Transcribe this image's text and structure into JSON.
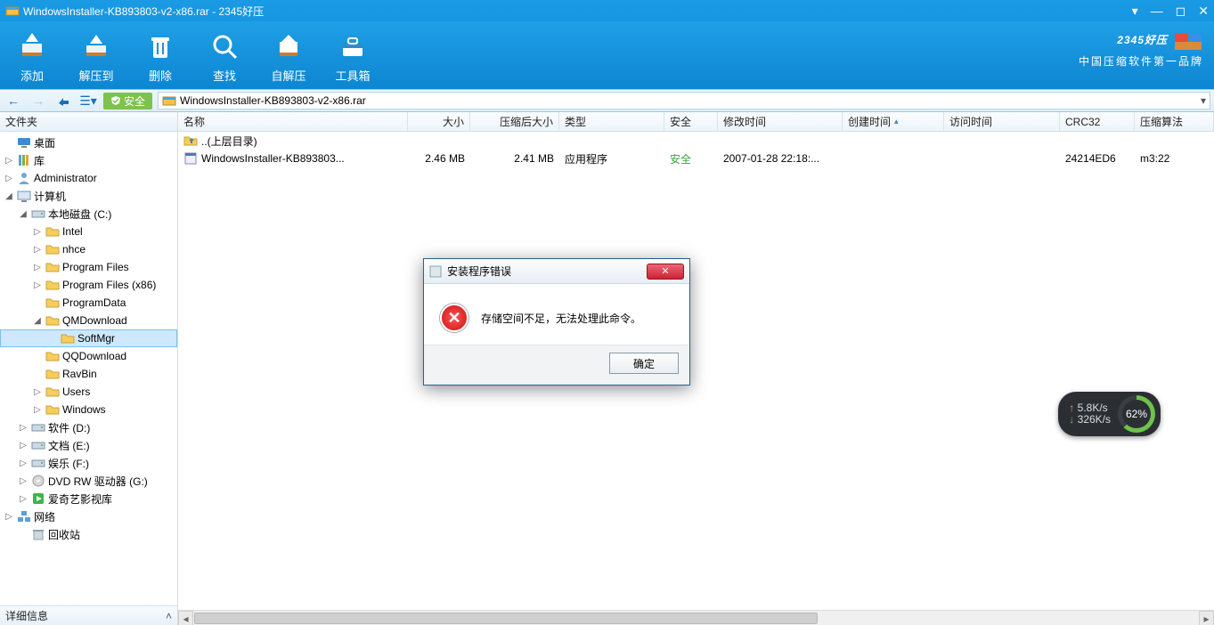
{
  "window": {
    "title": "WindowsInstaller-KB893803-v2-x86.rar - 2345好压"
  },
  "branding": {
    "logo": "2345好压",
    "tagline": "中国压缩软件第一品牌"
  },
  "toolbar": {
    "add": {
      "label": "添加"
    },
    "extract": {
      "label": "解压到"
    },
    "delete": {
      "label": "删除"
    },
    "search": {
      "label": "查找"
    },
    "sfx": {
      "label": "自解压"
    },
    "tools": {
      "label": "工具箱"
    }
  },
  "navbar": {
    "safe_label": "安全",
    "path": "WindowsInstaller-KB893803-v2-x86.rar"
  },
  "sidebar": {
    "header": "文件夹",
    "footer": "详细信息",
    "nodes": [
      {
        "indent": 0,
        "tw": "",
        "icon": "desktop",
        "label": "桌面"
      },
      {
        "indent": 0,
        "tw": "▷",
        "icon": "library",
        "label": "库"
      },
      {
        "indent": 0,
        "tw": "▷",
        "icon": "user",
        "label": "Administrator"
      },
      {
        "indent": 0,
        "tw": "◢",
        "icon": "computer",
        "label": "计算机"
      },
      {
        "indent": 1,
        "tw": "◢",
        "icon": "drive",
        "label": "本地磁盘 (C:)"
      },
      {
        "indent": 2,
        "tw": "▷",
        "icon": "folder",
        "label": "Intel"
      },
      {
        "indent": 2,
        "tw": "▷",
        "icon": "folder",
        "label": "nhce"
      },
      {
        "indent": 2,
        "tw": "▷",
        "icon": "folder",
        "label": "Program Files"
      },
      {
        "indent": 2,
        "tw": "▷",
        "icon": "folder",
        "label": "Program Files (x86)"
      },
      {
        "indent": 2,
        "tw": "",
        "icon": "folder",
        "label": "ProgramData"
      },
      {
        "indent": 2,
        "tw": "◢",
        "icon": "folder",
        "label": "QMDownload"
      },
      {
        "indent": 3,
        "tw": "",
        "icon": "folder",
        "label": "SoftMgr",
        "selected": true
      },
      {
        "indent": 2,
        "tw": "",
        "icon": "folder",
        "label": "QQDownload"
      },
      {
        "indent": 2,
        "tw": "",
        "icon": "folder",
        "label": "RavBin"
      },
      {
        "indent": 2,
        "tw": "▷",
        "icon": "folder",
        "label": "Users"
      },
      {
        "indent": 2,
        "tw": "▷",
        "icon": "folder",
        "label": "Windows"
      },
      {
        "indent": 1,
        "tw": "▷",
        "icon": "drive",
        "label": "软件 (D:)"
      },
      {
        "indent": 1,
        "tw": "▷",
        "icon": "drive",
        "label": "文档 (E:)"
      },
      {
        "indent": 1,
        "tw": "▷",
        "icon": "drive",
        "label": "娱乐 (F:)"
      },
      {
        "indent": 1,
        "tw": "▷",
        "icon": "dvd",
        "label": "DVD RW 驱动器 (G:)"
      },
      {
        "indent": 1,
        "tw": "▷",
        "icon": "app",
        "label": "爱奇艺影视库"
      },
      {
        "indent": 0,
        "tw": "▷",
        "icon": "network",
        "label": "网络"
      },
      {
        "indent": 1,
        "tw": "",
        "icon": "recycle",
        "label": "回收站"
      }
    ]
  },
  "columns": {
    "name": "名称",
    "size": "大小",
    "packed": "压缩后大小",
    "type": "类型",
    "safe": "安全",
    "modified": "修改时间",
    "created": "创建时间",
    "accessed": "访问时间",
    "crc": "CRC32",
    "algo": "压缩算法"
  },
  "rows": [
    {
      "name": "..(上层目录)",
      "icon": "folder-up",
      "size": "",
      "packed": "",
      "type": "",
      "safe": "",
      "modified": "",
      "created": "",
      "accessed": "",
      "crc": "",
      "algo": ""
    },
    {
      "name": "WindowsInstaller-KB893803...",
      "icon": "exe",
      "size": "2.46 MB",
      "packed": "2.41 MB",
      "type": "应用程序",
      "safe": "安全",
      "modified": "2007-01-28 22:18:...",
      "created": "",
      "accessed": "",
      "crc": "24214ED6",
      "algo": "m3:22"
    }
  ],
  "dialog": {
    "title": "安装程序错误",
    "message": "存储空间不足，无法处理此命令。",
    "ok": "确定"
  },
  "widget": {
    "up": "5.8K/s",
    "down": "326K/s",
    "percent": "62%"
  }
}
